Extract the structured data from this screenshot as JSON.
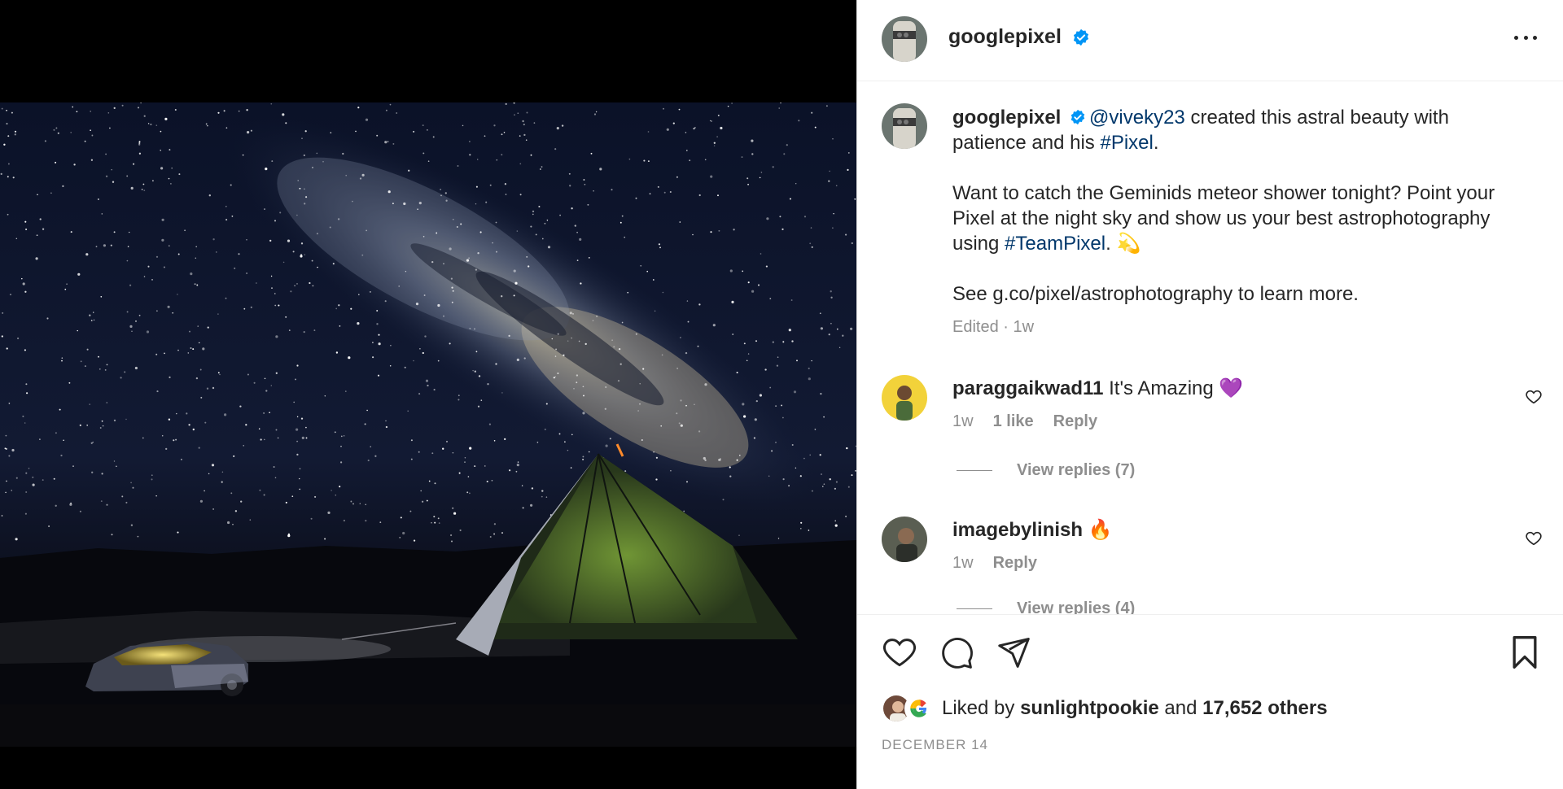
{
  "post": {
    "username": "googlepixel",
    "caption": {
      "username": "googlepixel",
      "mention": "@viveky23",
      "line1_rest": " created this astral beauty with patience and his ",
      "hashtag1": "#Pixel",
      "line1_end": ".",
      "para2_text": "Want to catch the Geminids meteor shower tonight? Point your Pixel at the night sky and show us your best astrophotography using ",
      "hashtag2": "#TeamPixel",
      "para2_end": ". 💫",
      "para3": "See g.co/pixel/astrophotography to learn more."
    },
    "edited_label": "Edited · 1w"
  },
  "comments": [
    {
      "username": "paraggaikwad11",
      "text": " It's Amazing 💜",
      "time": "1w",
      "likes": "1 like",
      "reply": "Reply",
      "view_replies": "View replies (7)"
    },
    {
      "username": "imagebylinish",
      "text": " 🔥",
      "time": "1w",
      "reply": "Reply",
      "view_replies": "View replies (4)"
    }
  ],
  "footer": {
    "liked_by_prefix": "Liked by ",
    "liked_by_user": "sunlightpookie",
    "liked_by_and": " and ",
    "liked_by_others": "17,652 others",
    "date": "DECEMBER 14"
  },
  "icons": {
    "verified": "verified-badge-icon",
    "more": "more-options-icon",
    "heart": "heart-icon",
    "comment": "comment-icon",
    "share": "share-icon",
    "save": "bookmark-icon"
  },
  "colors": {
    "link": "#00376b",
    "verified": "#0095f6",
    "muted": "#8e8e8e",
    "text": "#262626"
  }
}
